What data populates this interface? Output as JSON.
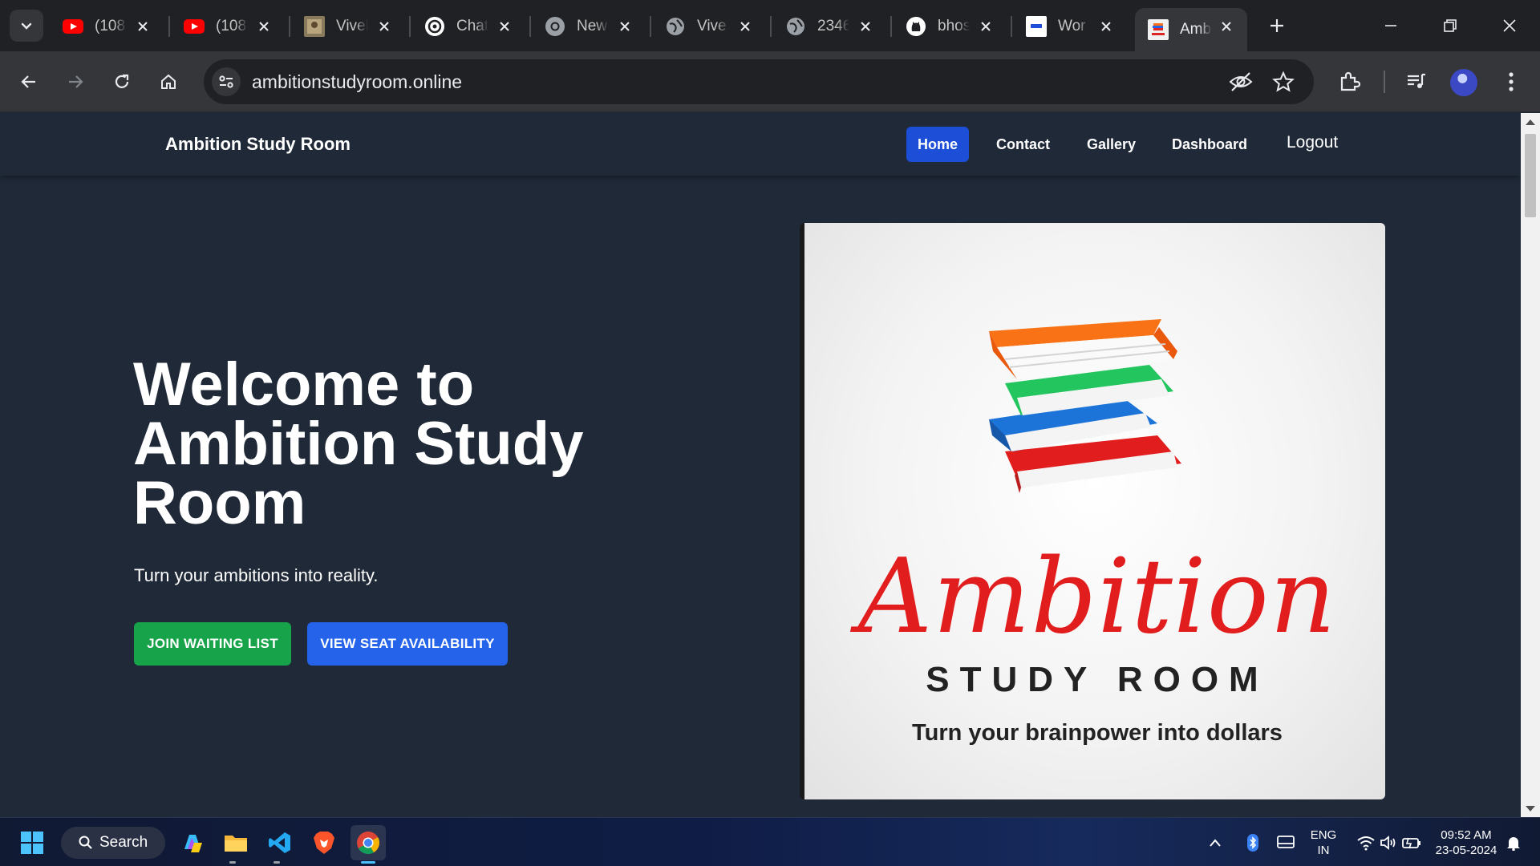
{
  "browser": {
    "tabs": [
      {
        "title": "(108",
        "icon": "youtube-icon"
      },
      {
        "title": "(108",
        "icon": "youtube-icon"
      },
      {
        "title": "Vivel",
        "icon": "photo-favicon"
      },
      {
        "title": "Chat",
        "icon": "chatgpt-icon"
      },
      {
        "title": "New",
        "icon": "chrome-icon"
      },
      {
        "title": "Vive",
        "icon": "globe-icon"
      },
      {
        "title": "2346",
        "icon": "globe-icon"
      },
      {
        "title": "bhos",
        "icon": "github-icon"
      },
      {
        "title": "Wor",
        "icon": "site-favicon"
      },
      {
        "title": "Amb",
        "icon": "ambition-favicon",
        "active": true
      }
    ],
    "url": "ambitionstudyroom.online"
  },
  "site": {
    "brand": "Ambition Study Room",
    "nav": {
      "home": "Home",
      "contact": "Contact",
      "gallery": "Gallery",
      "dashboard": "Dashboard",
      "logout": "Logout"
    },
    "hero": {
      "title": "Welcome to Ambition Study Room",
      "subtitle": "Turn your ambitions into reality.",
      "join_button": "JOIN WAITING LIST",
      "seat_button": "VIEW SEAT AVAILABILITY"
    },
    "logo": {
      "word": "Ambition",
      "sub": "STUDY ROOM",
      "tagline": "Turn your brainpower into dollars"
    }
  },
  "taskbar": {
    "search": "Search",
    "lang_top": "ENG",
    "lang_bottom": "IN",
    "time": "09:52 AM",
    "date": "23-05-2024"
  },
  "colors": {
    "page_bg": "#1f2937",
    "active_nav": "#1d4ed8",
    "join_button": "#16a34a",
    "seat_button": "#2563eb",
    "logo_red": "#e11d1d"
  }
}
